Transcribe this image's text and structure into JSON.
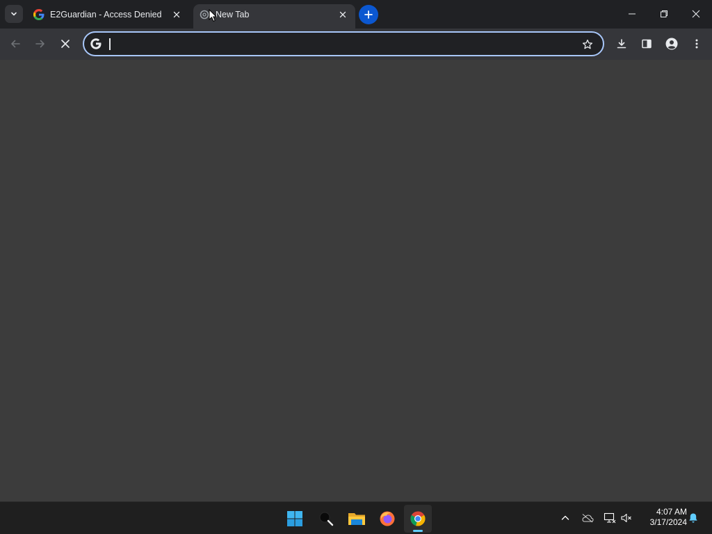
{
  "browser": {
    "tabs": [
      {
        "title": "E2Guardian - Access Denied",
        "icon": "google-g-icon",
        "active": false
      },
      {
        "title": "New Tab",
        "icon": "loading-spinner-icon",
        "active": true
      }
    ],
    "tab_search_icon": "chevron-down-icon",
    "new_tab_icon": "plus-icon",
    "window_controls": [
      "minimize-icon",
      "restore-icon",
      "close-icon"
    ]
  },
  "toolbar": {
    "back_icon": "arrow-left-icon",
    "forward_icon": "arrow-right-icon",
    "stop_icon": "close-icon",
    "omnibox": {
      "value": "",
      "placeholder": "",
      "icon": "google-g-icon",
      "focused": true
    },
    "bookmark_icon": "star-icon",
    "right_icons": [
      "download-icon",
      "side-panel-icon",
      "profile-icon",
      "kebab-menu-icon"
    ]
  },
  "taskbar": {
    "apps": [
      {
        "name": "Start",
        "icon": "windows-start-icon"
      },
      {
        "name": "Search",
        "icon": "search-icon"
      },
      {
        "name": "File Explorer",
        "icon": "folder-icon"
      },
      {
        "name": "Firefox",
        "icon": "firefox-icon"
      },
      {
        "name": "Chrome",
        "icon": "chrome-icon",
        "active": true
      }
    ],
    "tray_icons": [
      "chevron-up-icon",
      "onedrive-offline-icon",
      "network-icon",
      "volume-muted-icon"
    ],
    "clock": {
      "time": "4:07 AM",
      "date": "3/17/2024"
    },
    "notification_icon": "bell-icon"
  },
  "colors": {
    "accent": "#a8c7fa",
    "new_tab_button": "#0b57d0",
    "content_bg": "#3c3c3c",
    "taskbar_indicator": "#60cdff"
  }
}
